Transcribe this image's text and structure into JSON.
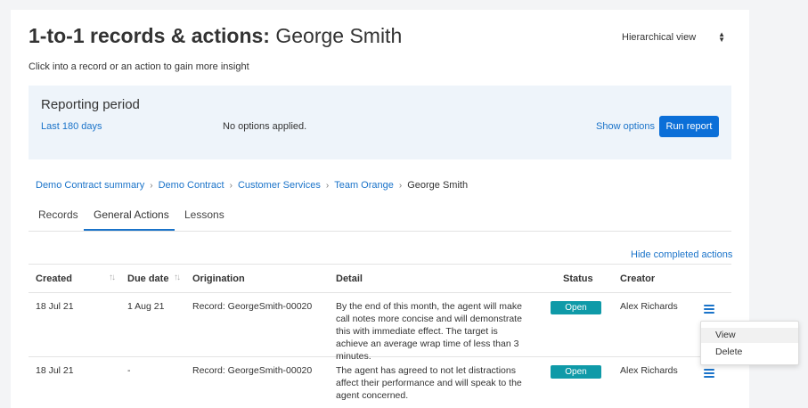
{
  "header": {
    "title_prefix": "1-to-1 records & actions:",
    "title_name": "George Smith",
    "subtitle": "Click into a record or an action to gain more insight",
    "view_select": "Hierarchical view"
  },
  "reporting": {
    "title": "Reporting period",
    "period": "Last 180 days",
    "options_text": "No options applied.",
    "show_options": "Show options",
    "run_report": "Run report"
  },
  "breadcrumb": {
    "links": [
      "Demo Contract summary",
      "Demo Contract",
      "Customer Services",
      "Team Orange"
    ],
    "current": "George Smith"
  },
  "tabs": [
    "Records",
    "General Actions",
    "Lessons"
  ],
  "active_tab": "General Actions",
  "hide_completed": "Hide completed actions",
  "table": {
    "headers": {
      "created": "Created",
      "due": "Due date",
      "origination": "Origination",
      "detail": "Detail",
      "status": "Status",
      "creator": "Creator"
    },
    "rows": [
      {
        "created": "18 Jul 21",
        "due": "1 Aug 21",
        "origination": "Record: GeorgeSmith-00020",
        "detail": "By the end of this month, the agent will make call notes more concise and will demonstrate this with immediate effect. The target is achieve an average wrap time of less than 3 minutes.",
        "status": "Open",
        "creator": "Alex Richards"
      },
      {
        "created": "18 Jul 21",
        "due": "-",
        "origination": "Record: GeorgeSmith-00020",
        "detail": "The agent has agreed to not let distractions affect their performance and will speak to the agent concerned.",
        "status": "Open",
        "creator": "Alex Richards"
      }
    ]
  },
  "row_menu": {
    "items": [
      "View",
      "Delete"
    ]
  },
  "colors": {
    "accent": "#0b6fd8",
    "link": "#1a73c9",
    "status_open": "#0f9aa8",
    "report_bg": "#eef4fa"
  }
}
